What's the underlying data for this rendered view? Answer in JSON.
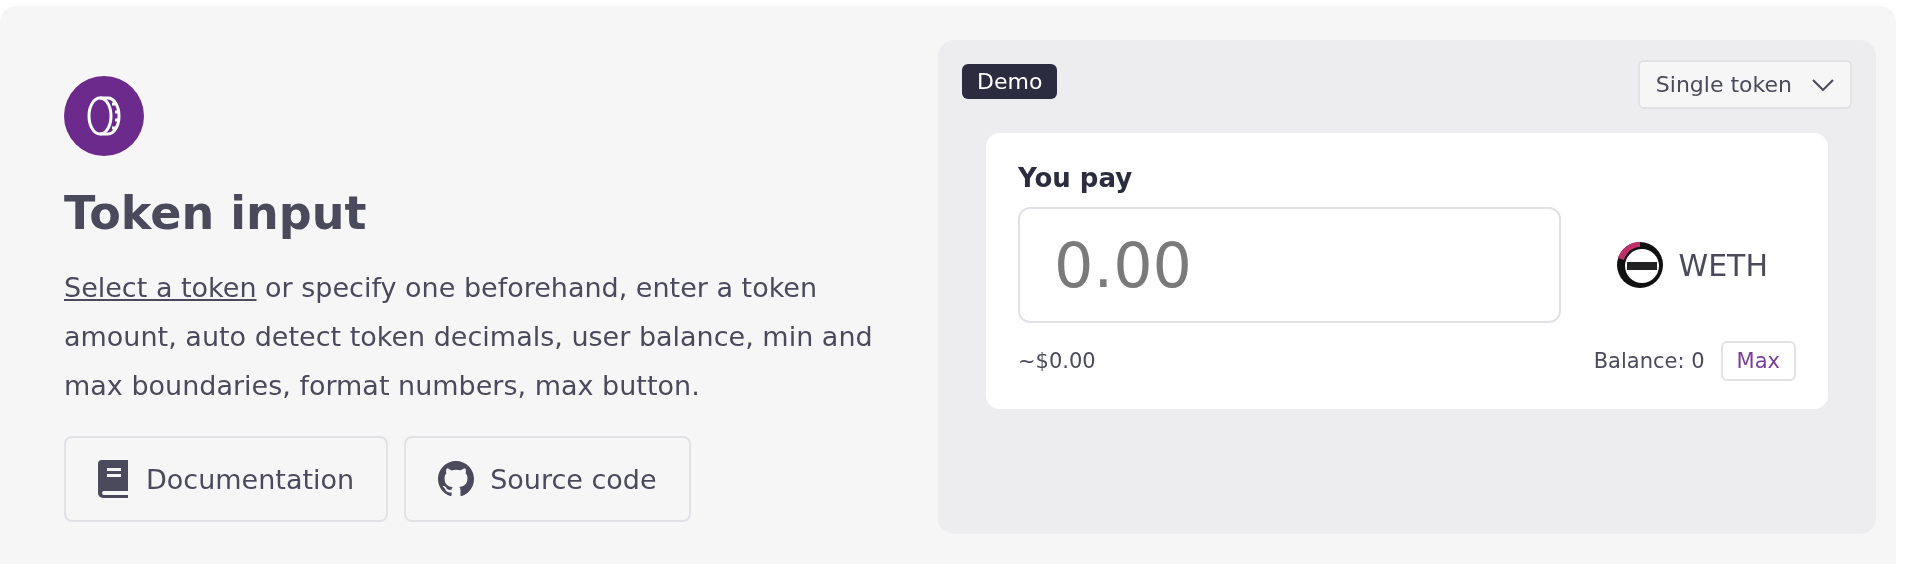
{
  "title": "Token input",
  "description": {
    "link": "Select a token",
    "text": " or specify one beforehand, enter a token amount, auto detect token decimals, user balance, min and max boundaries, format numbers, max button."
  },
  "buttons": [
    {
      "kind": "docs",
      "label": "Documentation"
    },
    {
      "kind": "github",
      "label": "Source code"
    }
  ],
  "demo": {
    "badge": "Demo",
    "mode_select": "Single token",
    "label": "You pay",
    "placeholder": "0.00",
    "token": "WETH",
    "usd_value": "~$0.00",
    "balance": "Balance: 0",
    "max_button": "Max"
  }
}
